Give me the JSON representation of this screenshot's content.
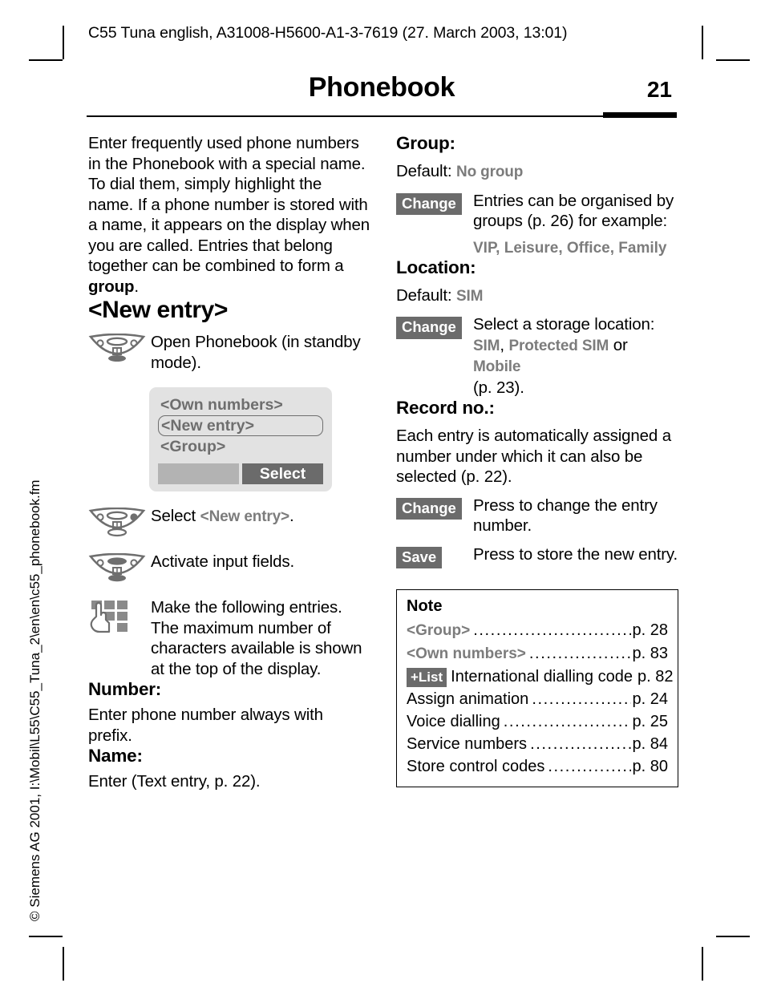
{
  "running_head": "C55 Tuna english, A31008-H5600-A1-3-7619 (27. March 2003, 13:01)",
  "header": {
    "title": "Phonebook",
    "page_number": "21"
  },
  "footer": {
    "doc_path": "© Siemens AG 2001, I:\\Mobil\\L55\\C55_Tuna_2\\en\\en\\c55_phonebook.fm"
  },
  "left_column": {
    "intro_html": "Enter frequently used phone numbers in the Phonebook with a special name. To dial them, simply highlight the name. If a phone number is stored with a name, it appears on the display when you are called. Entries that belong together can be combined to form a <b>group</b>.",
    "new_entry_heading": "<New entry>",
    "steps": [
      {
        "icon": "nav-key-open-icon",
        "text": "Open Phonebook (in standby mode)."
      },
      {
        "icon": "nav-key-scroll-icon",
        "text_prefix": "Select ",
        "text_term": "<New entry>",
        "text_suffix": "."
      },
      {
        "icon": "nav-key-press-icon",
        "text": "Activate input fields."
      },
      {
        "icon": "keypad-hand-icon",
        "text": "Make the following entries. The maximum number of characters available is shown at the top of the display."
      }
    ],
    "phone_display": {
      "lines": [
        {
          "label": "<Own numbers>",
          "selected": false
        },
        {
          "label": "<New entry>",
          "selected": true
        },
        {
          "label": "<Group>",
          "selected": false
        }
      ],
      "softkey_left": "",
      "softkey_right": "Select"
    },
    "number_section": {
      "heading": "Number:",
      "text": "Enter phone number always with prefix."
    },
    "name_section": {
      "heading": "Name:",
      "text": "Enter (Text entry, p. 22)."
    }
  },
  "right_column": {
    "group_section": {
      "heading": "Group:",
      "default_label": "Default:",
      "default_value": "No group",
      "change_button": "Change",
      "description": "Entries can be organised by groups (p. 26) for example:",
      "examples": "VIP, Leisure, Office, Family"
    },
    "location_section": {
      "heading": "Location:",
      "default_label": "Default:",
      "default_value": "SIM",
      "change_button": "Change",
      "desc_line1": "Select a storage location:",
      "desc_opt1": "SIM",
      "desc_sep1": ", ",
      "desc_opt2": "Protected SIM",
      "desc_sep2": " or ",
      "desc_opt3": "Mobile",
      "desc_line3": "(p. 23)."
    },
    "record_section": {
      "heading": "Record no.:",
      "description": "Each entry is automatically assigned a number under which it can also be selected (p. 22).",
      "rows": [
        {
          "key": "Change",
          "value": "Press to change the entry number."
        },
        {
          "key": "Save",
          "value": "Press to store the new entry."
        }
      ]
    },
    "note_box": {
      "title": "Note",
      "rows": [
        {
          "chip": "",
          "label": "<Group>",
          "label_style": "ui-term",
          "page": "p. 28"
        },
        {
          "chip": "",
          "label": "<Own numbers>",
          "label_style": "ui-term",
          "page": "p. 83"
        },
        {
          "chip": "+List",
          "label": "International dialling code",
          "label_style": "plain",
          "page": "p. 82"
        },
        {
          "chip": "",
          "label": "Assign animation",
          "label_style": "plain",
          "page": "p. 24"
        },
        {
          "chip": "",
          "label": "Voice dialling",
          "label_style": "plain",
          "page": "p. 25"
        },
        {
          "chip": "",
          "label": "Service numbers",
          "label_style": "plain",
          "page": "p. 84"
        },
        {
          "chip": "",
          "label": "Store control codes",
          "label_style": "plain",
          "page": "p. 80"
        }
      ]
    }
  },
  "colors": {
    "chip_bg": "#6b6b6b",
    "ui_term": "#7c7c7c",
    "display_bg": "#e2e2e2",
    "softkey_left": "#b3b3b3",
    "softkey_right": "#6b6b6b",
    "icon_gray": "#6e6e6e"
  }
}
